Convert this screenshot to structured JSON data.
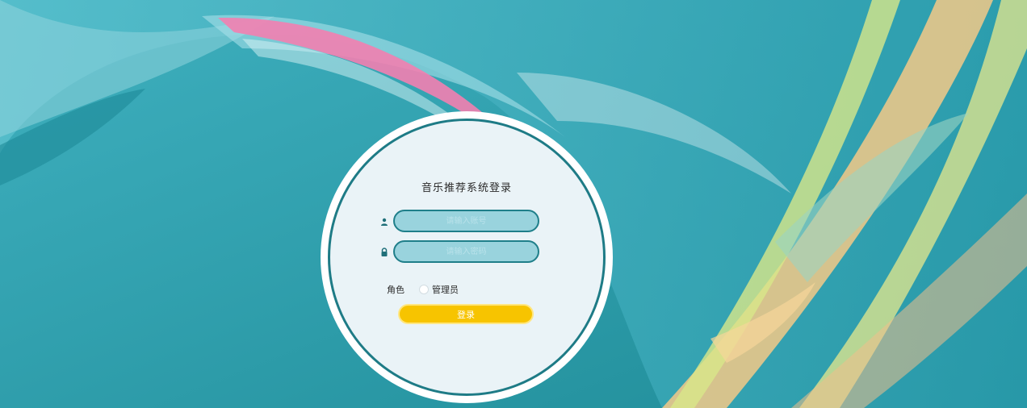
{
  "login": {
    "title": "音乐推荐系统登录",
    "username_placeholder": "请输入账号",
    "password_placeholder": "请输入密码",
    "role_label": "角色",
    "role_option": "管理员",
    "submit_label": "登录"
  },
  "icons": {
    "username": "user-icon",
    "password": "lock-icon"
  },
  "colors": {
    "accent": "#1f7f8a",
    "button": "#f7c400",
    "field_bg": "#99d3dd"
  }
}
